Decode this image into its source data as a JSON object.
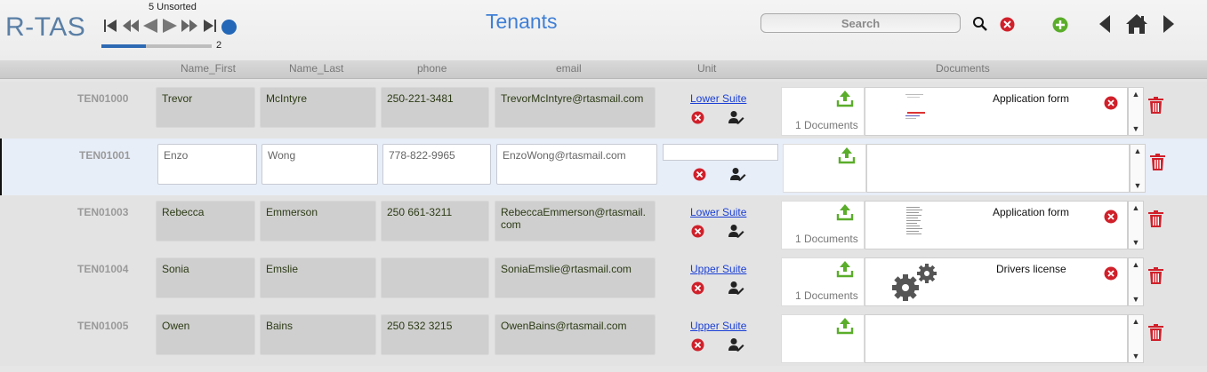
{
  "app": {
    "logo": "R-TAS",
    "title": "Tenants"
  },
  "nav": {
    "unsorted_label": "5 Unsorted",
    "record_number": "2",
    "progress": 0.4
  },
  "search": {
    "placeholder": "Search"
  },
  "columns": {
    "first": "Name_First",
    "last": "Name_Last",
    "phone": "phone",
    "email": "email",
    "unit": "Unit",
    "documents": "Documents"
  },
  "colors": {
    "accent": "#3f7fd6",
    "delete": "#d0202a",
    "upload": "#5aad2a",
    "link": "#1a3fd6"
  },
  "rows": [
    {
      "id": "TEN01000",
      "first": "Trevor",
      "last": "McIntyre",
      "phone": "250-221-3481",
      "email": "TrevorMcIntyre@rtasmail.com",
      "unit": "Lower Suite",
      "doc_count": "1 Documents",
      "doc_title": "Application form",
      "doc_thumb": "pdf"
    },
    {
      "id": "TEN01001",
      "first": "Enzo",
      "last": "Wong",
      "phone": "778-822-9965",
      "email": "EnzoWong@rtasmail.com",
      "unit": "",
      "doc_count": "",
      "doc_title": "",
      "doc_thumb": ""
    },
    {
      "id": "TEN01003",
      "first": "Rebecca",
      "last": "Emmerson",
      "phone": "250 661-3211",
      "email": "RebeccaEmmerson@rtasmail.\ncom",
      "unit": "Lower Suite",
      "doc_count": "1 Documents",
      "doc_title": "Application form",
      "doc_thumb": "page"
    },
    {
      "id": "TEN01004",
      "first": "Sonia",
      "last": "Emslie",
      "phone": "",
      "email": "SoniaEmslie@rtasmail.com",
      "unit": "Upper Suite",
      "doc_count": "1 Documents",
      "doc_title": "Drivers license",
      "doc_thumb": "gears"
    },
    {
      "id": "TEN01005",
      "first": "Owen",
      "last": "Bains",
      "phone": "250 532 3215",
      "email": "OwenBains@rtasmail.com",
      "unit": "Upper Suite",
      "doc_count": "",
      "doc_title": "",
      "doc_thumb": ""
    }
  ],
  "icons": [
    "first-record-icon",
    "rewind-icon",
    "previous-icon",
    "next-icon",
    "fast-forward-icon",
    "last-record-icon",
    "search-icon",
    "clear-search-icon",
    "add-icon",
    "back-icon",
    "home-icon",
    "forward-icon",
    "remove-icon",
    "edit-user-icon",
    "upload-icon",
    "trash-icon"
  ]
}
